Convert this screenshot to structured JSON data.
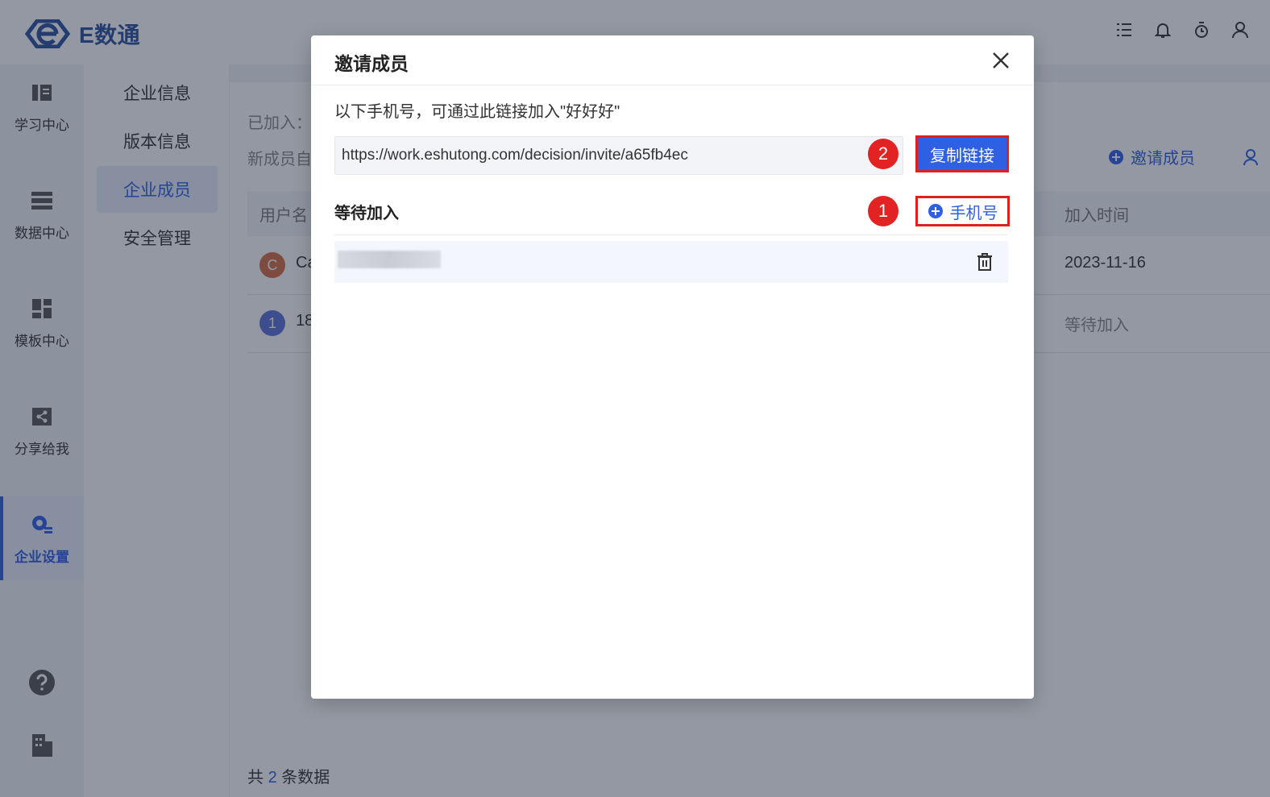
{
  "app": {
    "logo_text": "E数通",
    "top_icons": [
      "list-icon",
      "bell-icon",
      "timer-icon",
      "user-icon"
    ]
  },
  "left_nav": {
    "items": [
      {
        "label": "学习中心",
        "icon": "book-icon"
      },
      {
        "label": "数据中心",
        "icon": "database-icon"
      },
      {
        "label": "模板中心",
        "icon": "template-icon"
      },
      {
        "label": "分享给我",
        "icon": "share-icon"
      },
      {
        "label": "企业设置",
        "icon": "gear-icon",
        "active": true
      }
    ],
    "bottom_icons": [
      "help-icon",
      "building-icon"
    ]
  },
  "sub_nav": {
    "items": [
      {
        "label": "企业信息"
      },
      {
        "label": "版本信息"
      },
      {
        "label": "企业成员",
        "active": true
      },
      {
        "label": "安全管理"
      }
    ]
  },
  "main": {
    "joined_label": "已加入：",
    "new_member_label": "新成员自",
    "invite_label": "邀请成员",
    "table": {
      "headers": [
        "用户名",
        "加入时间"
      ],
      "rows": [
        {
          "avatar": "C",
          "avatar_color": "#d76b45",
          "name": "Ca",
          "join_time": "2023-11-16"
        },
        {
          "avatar": "1",
          "avatar_color": "#5b6fd6",
          "name": "18",
          "join_time": "等待加入"
        }
      ]
    },
    "footer": {
      "prefix": "共",
      "count": "2",
      "suffix": "条数据"
    }
  },
  "modal": {
    "title": "邀请成员",
    "description": "以下手机号，可通过此链接加入\"好好好\"",
    "link": "https://work.eshutong.com/decision/invite/a65fb4ec",
    "copy_button": "复制链接",
    "pending_title": "等待加入",
    "add_phone_button": "手机号",
    "badge_1": "1",
    "badge_2": "2"
  },
  "colors": {
    "accent": "#2f5fe3",
    "highlight_red": "#e01f1f",
    "badge_red": "#e32323"
  }
}
